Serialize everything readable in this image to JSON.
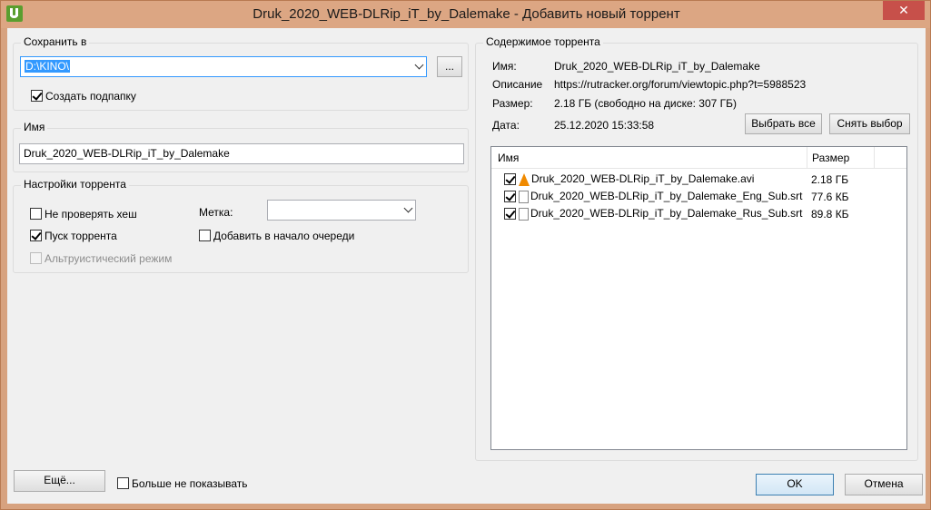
{
  "window": {
    "title": "Druk_2020_WEB-DLRip_iT_by_Dalemake - Добавить новый торрент",
    "close_glyph": "✕"
  },
  "save_in": {
    "group_label": "Сохранить в",
    "path_value": "D:\\KINO\\",
    "browse_label": "...",
    "create_subfolder_label": "Создать подпапку",
    "create_subfolder_checked": true
  },
  "name": {
    "group_label": "Имя",
    "value": "Druk_2020_WEB-DLRip_iT_by_Dalemake"
  },
  "torrent_settings": {
    "group_label": "Настройки торрента",
    "skip_hash_label": "Не проверять хеш",
    "skip_hash_checked": false,
    "start_label": "Пуск торрента",
    "start_checked": true,
    "altruistic_label": "Альтруистический режим",
    "altruistic_checked": false,
    "label_caption": "Метка:",
    "label_value": "",
    "add_to_top_label": "Добавить в начало очереди",
    "add_to_top_checked": false
  },
  "contents": {
    "group_label": "Содержимое торрента",
    "name_label": "Имя:",
    "name_value": "Druk_2020_WEB-DLRip_iT_by_Dalemake",
    "desc_label": "Описание",
    "desc_value": "https://rutracker.org/forum/viewtopic.php?t=5988523",
    "size_label": "Размер:",
    "size_value": "2.18 ГБ (свободно на диске: 307 ГБ)",
    "date_label": "Дата:",
    "date_value": "25.12.2020 15:33:58",
    "select_all_label": "Выбрать все",
    "deselect_label": "Снять выбор",
    "columns": {
      "name": "Имя",
      "size": "Размер"
    },
    "files": [
      {
        "name": "Druk_2020_WEB-DLRip_iT_by_Dalemake.avi",
        "size": "2.18 ГБ",
        "icon": "vlc-icon",
        "checked": true
      },
      {
        "name": "Druk_2020_WEB-DLRip_iT_by_Dalemake_Eng_Sub.srt",
        "size": "77.6 КБ",
        "icon": "file-icon",
        "checked": true
      },
      {
        "name": "Druk_2020_WEB-DLRip_iT_by_Dalemake_Rus_Sub.srt",
        "size": "89.8 КБ",
        "icon": "file-icon",
        "checked": true
      }
    ]
  },
  "footer": {
    "more_label": "Ещё...",
    "dont_show_label": "Больше не показывать",
    "dont_show_checked": false,
    "ok_label": "OK",
    "cancel_label": "Отмена"
  }
}
